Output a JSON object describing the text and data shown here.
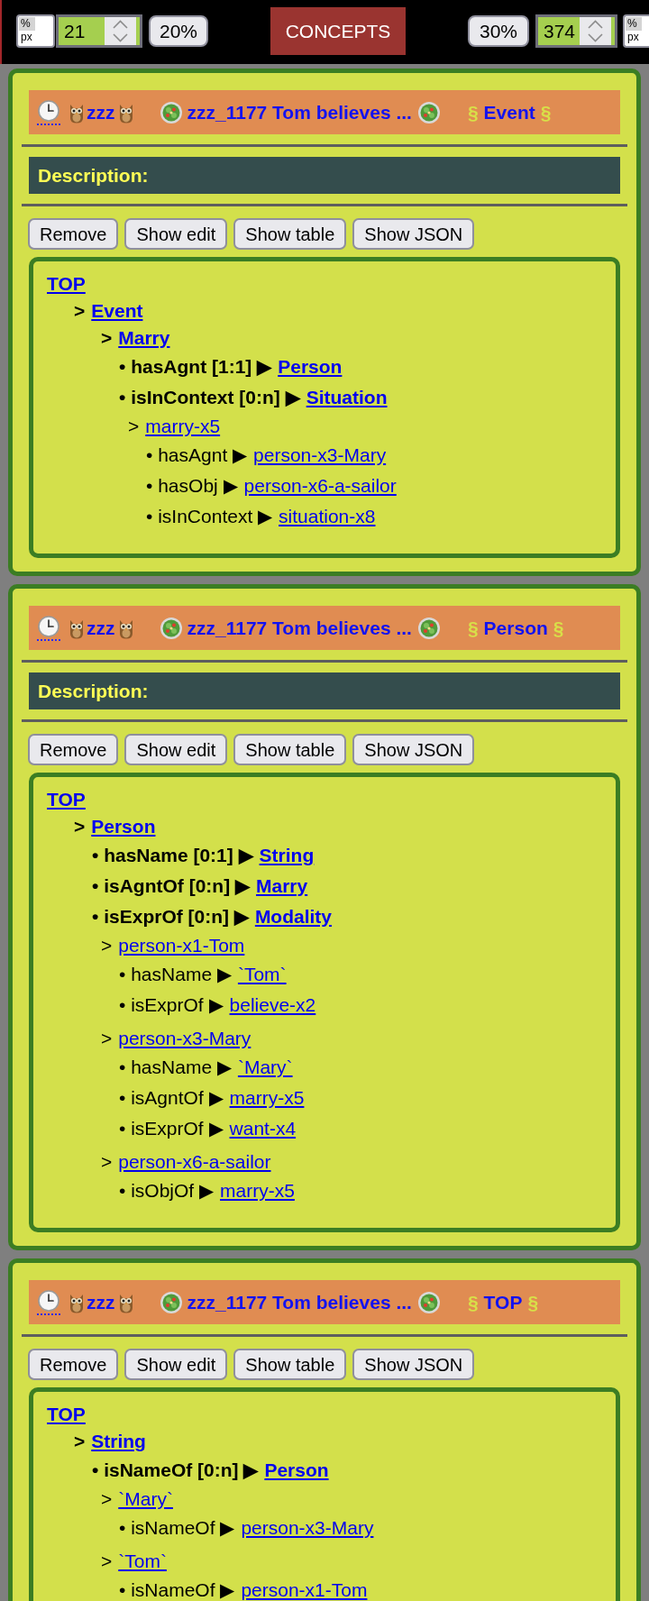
{
  "toolbar": {
    "left_unit": {
      "options": [
        {
          "label": "%",
          "selected": true
        },
        {
          "label": "px",
          "selected": false
        }
      ]
    },
    "left_size": {
      "value": "21"
    },
    "left_preset": "20%",
    "title": "CONCEPTS",
    "right_preset": "30%",
    "right_size": {
      "value": "374"
    },
    "right_unit": {
      "options": [
        {
          "label": "%",
          "selected": true
        },
        {
          "label": "px",
          "selected": false
        }
      ]
    }
  },
  "cards": [
    {
      "header": {
        "user": "zzz",
        "document": "zzz_1177 Tom believes ...",
        "mark_before": "§",
        "concept": "Event",
        "mark_after": "§"
      },
      "description": {
        "label": "Description:"
      },
      "buttons": [
        "Remove",
        "Show edit",
        "Show table",
        "Show JSON"
      ],
      "tree": {
        "label": "TOP",
        "children": [
          {
            "kind": "class",
            "marker": ">",
            "label": "Event",
            "children": [
              {
                "kind": "class",
                "marker": ">",
                "label": "Marry",
                "children": [
                  {
                    "kind": "property",
                    "text": "• hasAgnt [1:1] ▶",
                    "target": "Person"
                  },
                  {
                    "kind": "property",
                    "text": "• isInContext [0:n] ▶",
                    "target": "Situation"
                  },
                  {
                    "kind": "instance",
                    "marker": ">",
                    "label": "marry-x5",
                    "children": [
                      {
                        "kind": "relation",
                        "text": "• hasAgnt ▶",
                        "target": "person-x3-Mary"
                      },
                      {
                        "kind": "relation",
                        "text": "• hasObj ▶",
                        "target": "person-x6-a-sailor"
                      },
                      {
                        "kind": "relation",
                        "text": "• isInContext ▶",
                        "target": "situation-x8"
                      }
                    ]
                  }
                ]
              }
            ]
          }
        ]
      }
    },
    {
      "header": {
        "user": "zzz",
        "document": "zzz_1177 Tom believes ...",
        "mark_before": "§",
        "concept": "Person",
        "mark_after": "§"
      },
      "description": {
        "label": "Description:"
      },
      "buttons": [
        "Remove",
        "Show edit",
        "Show table",
        "Show JSON"
      ],
      "tree": {
        "label": "TOP",
        "children": [
          {
            "kind": "class",
            "marker": ">",
            "label": "Person",
            "children": [
              {
                "kind": "property",
                "text": "• hasName [0:1] ▶",
                "target": "String"
              },
              {
                "kind": "property",
                "text": "• isAgntOf [0:n] ▶",
                "target": "Marry"
              },
              {
                "kind": "property",
                "text": "• isExprOf [0:n] ▶",
                "target": "Modality"
              },
              {
                "kind": "instance",
                "marker": ">",
                "label": "person-x1-Tom",
                "children": [
                  {
                    "kind": "relation",
                    "text": "• hasName ▶",
                    "target": "`Tom`"
                  },
                  {
                    "kind": "relation",
                    "text": "• isExprOf ▶",
                    "target": "believe-x2"
                  }
                ]
              },
              {
                "kind": "instance",
                "marker": ">",
                "label": "person-x3-Mary",
                "children": [
                  {
                    "kind": "relation",
                    "text": "• hasName ▶",
                    "target": "`Mary`"
                  },
                  {
                    "kind": "relation",
                    "text": "• isAgntOf ▶",
                    "target": "marry-x5"
                  },
                  {
                    "kind": "relation",
                    "text": "• isExprOf ▶",
                    "target": "want-x4"
                  }
                ]
              },
              {
                "kind": "instance",
                "marker": ">",
                "label": "person-x6-a-sailor",
                "children": [
                  {
                    "kind": "relation",
                    "text": "• isObjOf ▶",
                    "target": "marry-x5"
                  }
                ]
              }
            ]
          }
        ]
      }
    },
    {
      "header": {
        "user": "zzz",
        "document": "zzz_1177 Tom believes ...",
        "mark_before": "§",
        "concept": "TOP",
        "mark_after": "§"
      },
      "buttons": [
        "Remove",
        "Show edit",
        "Show table",
        "Show JSON"
      ],
      "tree": {
        "label": "TOP",
        "children": [
          {
            "kind": "class",
            "marker": ">",
            "label": "String",
            "children": [
              {
                "kind": "property",
                "text": "• isNameOf [0:n] ▶",
                "target": "Person"
              },
              {
                "kind": "instance",
                "marker": ">",
                "label": "`Mary`",
                "children": [
                  {
                    "kind": "relation",
                    "text": "• isNameOf ▶",
                    "target": "person-x3-Mary"
                  }
                ]
              },
              {
                "kind": "instance",
                "marker": ">",
                "label": "`Tom`",
                "children": [
                  {
                    "kind": "relation",
                    "text": "• isNameOf ▶",
                    "target": "person-x1-Tom"
                  }
                ]
              }
            ]
          }
        ]
      }
    }
  ]
}
